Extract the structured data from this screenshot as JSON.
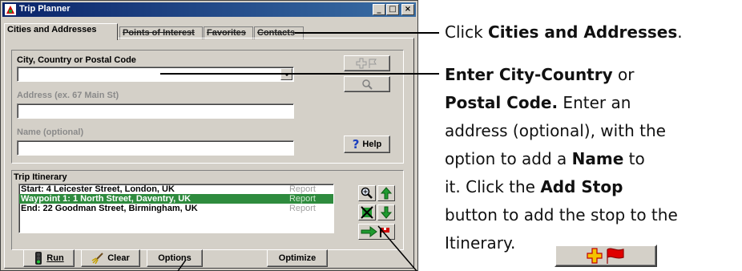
{
  "window": {
    "title": "Trip Planner"
  },
  "tabs": [
    {
      "label": "Cities and Addresses"
    },
    {
      "label": "Points of Interest"
    },
    {
      "label": "Favorites"
    },
    {
      "label": "Contacts"
    }
  ],
  "form": {
    "city_label": "City, Country or Postal Code",
    "city_value": "",
    "address_label": "Address (ex. 67 Main St)",
    "address_value": "",
    "name_label": "Name (optional)",
    "name_value": "",
    "help_label": "Help"
  },
  "itinerary": {
    "label": "Trip Itinerary",
    "rows": [
      {
        "text": "Start: 4 Leicester Street, London, UK",
        "report": "Report"
      },
      {
        "text": "Waypoint 1: 1 North Street, Daventry, UK",
        "report": "Report"
      },
      {
        "text": "End: 22 Goodman Street, Birmingham, UK",
        "report": "Report"
      }
    ]
  },
  "bottom_buttons": {
    "run": "Run",
    "clear": "Clear",
    "options": "Options",
    "optimize": "Optimize"
  },
  "instructions": {
    "line1_pre": "Click ",
    "line1_bold": "Cities and Addresses",
    "line1_post": ".",
    "p2_bold1": "Enter City-Country",
    "p2_t1": " or",
    "p2_bold2": "Postal Code.",
    "p2_t2": "  Enter an",
    "p2_t3": "address (optional), with the",
    "p2_t4": "option to add a ",
    "p2_bold3": "Name",
    "p2_t5": " to",
    "p2_t6": "it.  Click the ",
    "p2_bold4": "Add Stop",
    "p2_t7": "button to add the stop to the",
    "p2_t8": "Itinerary."
  },
  "colors": {
    "titlebar": "#0a246a",
    "selected_row": "#2e8b3e",
    "accent_red": "#d00000",
    "arrow_green": "#1f9a2f"
  }
}
